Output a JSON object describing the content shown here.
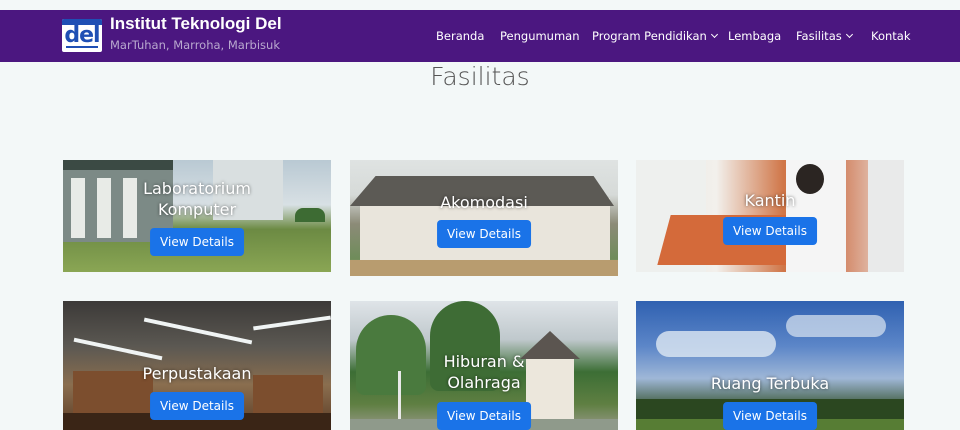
{
  "navbar": {
    "logo_text": "del",
    "brand_title": "Institut Teknologi Del",
    "brand_subtitle": "MarTuhan, Marroha, Marbisuk",
    "items": [
      {
        "label": "Beranda"
      },
      {
        "label": "Pengumuman"
      },
      {
        "label": "Program Pendidikan"
      },
      {
        "label": "Lembaga"
      },
      {
        "label": "Fasilitas"
      },
      {
        "label": "Kontak"
      }
    ],
    "colors": {
      "bar": "#4b1780",
      "subtitle": "#b9a9cf"
    }
  },
  "section": {
    "title": "Fasilitas"
  },
  "facilities": [
    {
      "name": "Laboratorium Komputer",
      "button": "View Details"
    },
    {
      "name": "Akomodasi",
      "button": "View Details"
    },
    {
      "name": "Kantin",
      "button": "View Details"
    },
    {
      "name": "Perpustakaan",
      "button": "View Details"
    },
    {
      "name": "Hiburan & Olahraga",
      "button": "View Details"
    },
    {
      "name": "Ruang Terbuka",
      "button": "View Details"
    }
  ],
  "colors": {
    "accent_button": "#1a73e8",
    "page_background": "#f3f8f8"
  }
}
